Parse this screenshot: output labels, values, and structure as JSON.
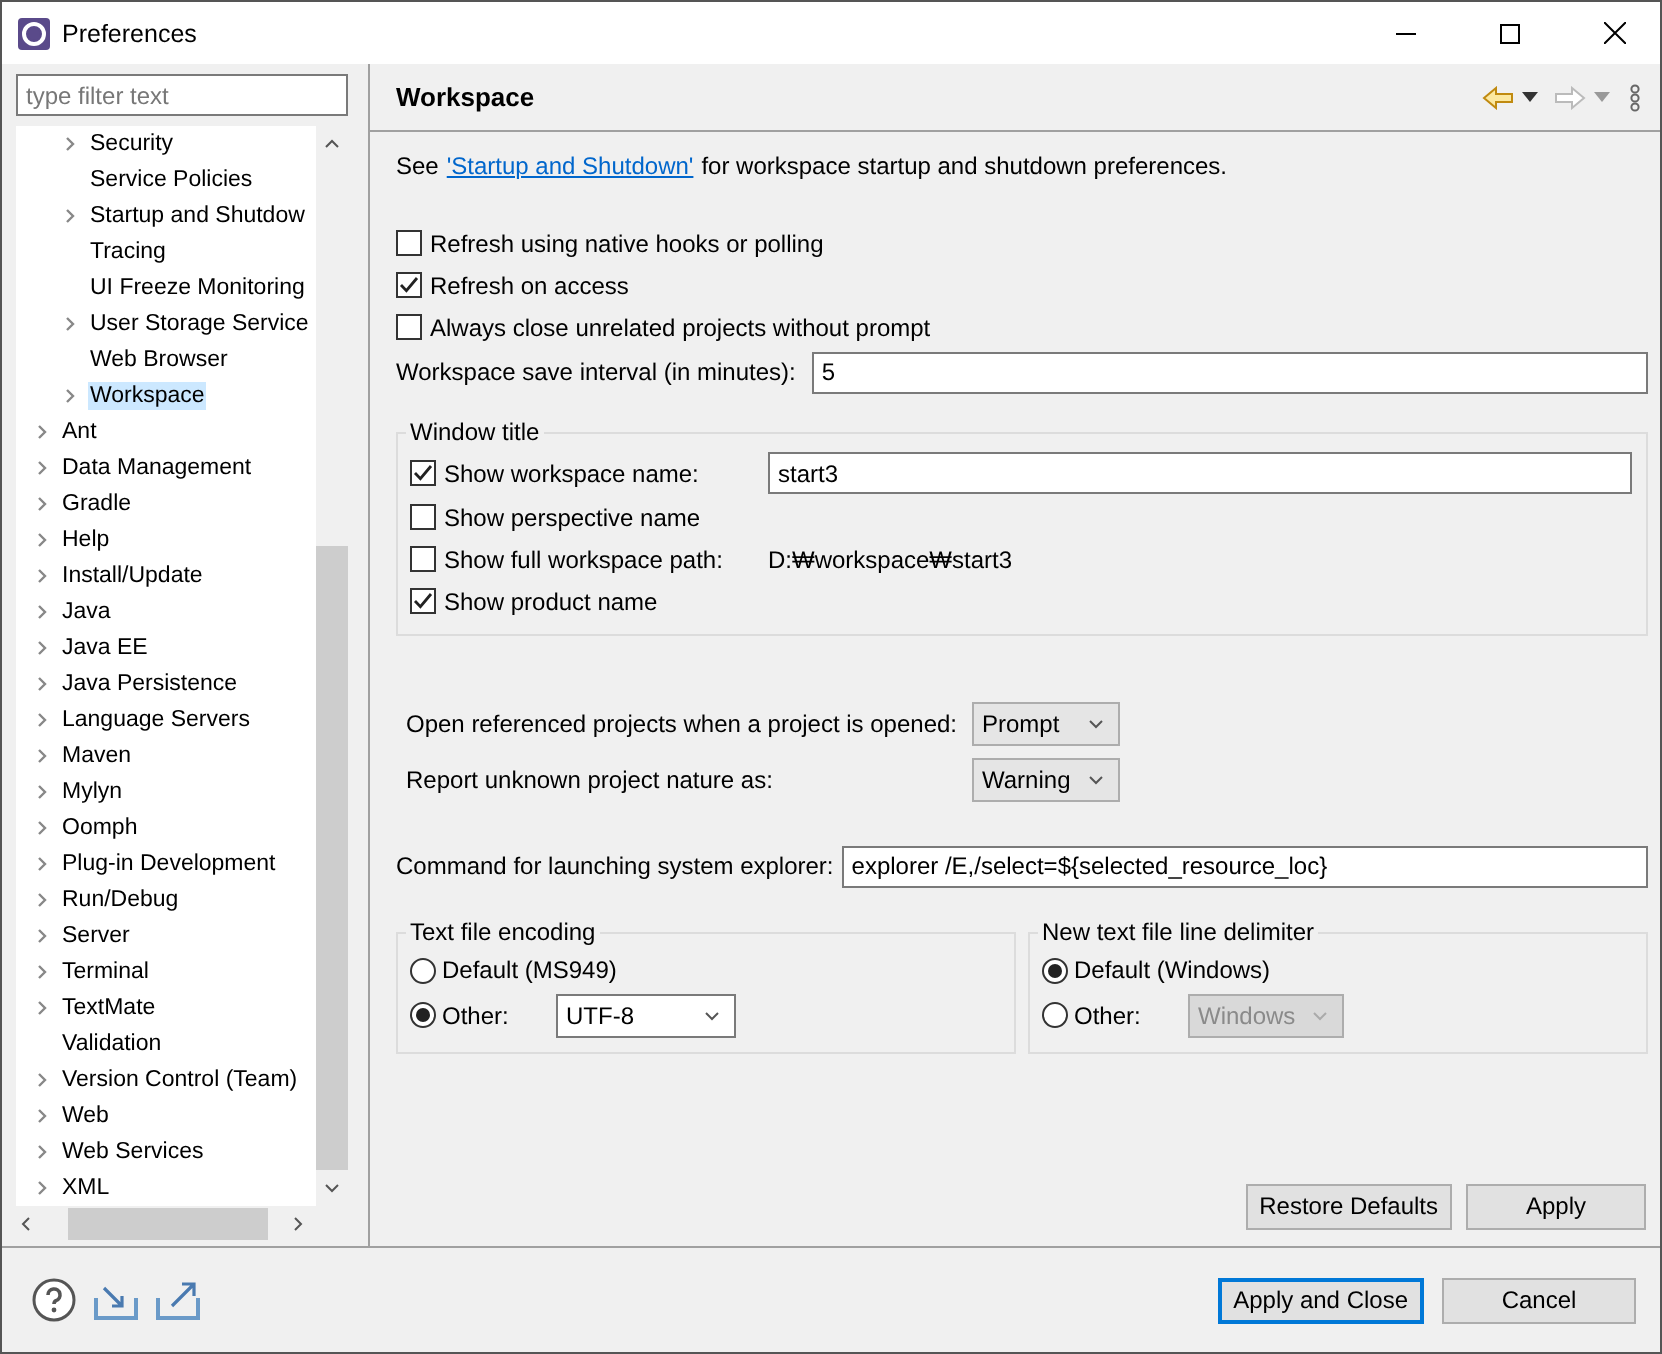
{
  "window": {
    "title": "Preferences"
  },
  "filter": {
    "placeholder": "type filter text"
  },
  "tree": {
    "nested_items": [
      {
        "label": "Security",
        "expandable": true,
        "selected": false
      },
      {
        "label": "Service Policies",
        "expandable": false,
        "selected": false
      },
      {
        "label": "Startup and Shutdow",
        "expandable": true,
        "selected": false
      },
      {
        "label": "Tracing",
        "expandable": false,
        "selected": false
      },
      {
        "label": "UI Freeze Monitoring",
        "expandable": false,
        "selected": false
      },
      {
        "label": "User Storage Service",
        "expandable": true,
        "selected": false
      },
      {
        "label": "Web Browser",
        "expandable": false,
        "selected": false
      },
      {
        "label": "Workspace",
        "expandable": true,
        "selected": true
      }
    ],
    "items": [
      {
        "label": "Ant",
        "expandable": true,
        "selected": false
      },
      {
        "label": "Data Management",
        "expandable": true,
        "selected": false
      },
      {
        "label": "Gradle",
        "expandable": true,
        "selected": false
      },
      {
        "label": "Help",
        "expandable": true,
        "selected": false
      },
      {
        "label": "Install/Update",
        "expandable": true,
        "selected": false
      },
      {
        "label": "Java",
        "expandable": true,
        "selected": false
      },
      {
        "label": "Java EE",
        "expandable": true,
        "selected": false
      },
      {
        "label": "Java Persistence",
        "expandable": true,
        "selected": false
      },
      {
        "label": "Language Servers",
        "expandable": true,
        "selected": false
      },
      {
        "label": "Maven",
        "expandable": true,
        "selected": false
      },
      {
        "label": "Mylyn",
        "expandable": true,
        "selected": false
      },
      {
        "label": "Oomph",
        "expandable": true,
        "selected": false
      },
      {
        "label": "Plug-in Development",
        "expandable": true,
        "selected": false
      },
      {
        "label": "Run/Debug",
        "expandable": true,
        "selected": false
      },
      {
        "label": "Server",
        "expandable": true,
        "selected": false
      },
      {
        "label": "Terminal",
        "expandable": true,
        "selected": false
      },
      {
        "label": "TextMate",
        "expandable": true,
        "selected": false
      },
      {
        "label": "Validation",
        "expandable": false,
        "selected": false
      },
      {
        "label": "Version Control (Team)",
        "expandable": true,
        "selected": false
      },
      {
        "label": "Web",
        "expandable": true,
        "selected": false
      },
      {
        "label": "Web Services",
        "expandable": true,
        "selected": false
      },
      {
        "label": "XML",
        "expandable": true,
        "selected": false
      }
    ]
  },
  "page": {
    "title": "Workspace",
    "intro": {
      "before": "See",
      "link": "'Startup and Shutdown'",
      "after": "for workspace startup and shutdown preferences."
    },
    "options": [
      {
        "label": "Refresh using native hooks or polling",
        "checked": false
      },
      {
        "label": "Refresh on access",
        "checked": true
      },
      {
        "label": "Always close unrelated projects without prompt",
        "checked": false
      }
    ],
    "save_interval": {
      "label": "Workspace save interval (in minutes):",
      "value": "5"
    },
    "window_title": {
      "title": "Window title",
      "rows": [
        {
          "kind": "input",
          "label": "Show workspace name:",
          "checked": true,
          "value": "start3"
        },
        {
          "kind": "plain",
          "label": "Show perspective name",
          "checked": false
        },
        {
          "kind": "text",
          "label": "Show full workspace path:",
          "checked": false,
          "value": "D:₩workspace₩start3"
        },
        {
          "kind": "plain",
          "label": "Show product name",
          "checked": true
        }
      ]
    },
    "selects": [
      {
        "label": "Open referenced projects when a project is opened:",
        "value": "Prompt"
      },
      {
        "label": "Report unknown project nature as:",
        "value": "Warning"
      }
    ],
    "explorer": {
      "label": "Command for launching system explorer:",
      "value": "explorer /E,/select=${selected_resource_loc}"
    },
    "encoding": {
      "title": "Text file encoding",
      "options": [
        {
          "kind": "plain",
          "label": "Default (MS949)",
          "selected": false
        },
        {
          "kind": "combo",
          "label": "Other:",
          "selected": true,
          "value": "UTF-8",
          "disabled": false
        }
      ]
    },
    "delimiter": {
      "title": "New text file line delimiter",
      "options": [
        {
          "kind": "plain",
          "label": "Default (Windows)",
          "selected": true
        },
        {
          "kind": "combo",
          "label": "Other:",
          "selected": false,
          "value": "Windows",
          "disabled": true
        }
      ]
    },
    "buttons": [
      "Restore Defaults",
      "Apply"
    ]
  },
  "footer_buttons": [
    {
      "label": "Apply and Close",
      "default": true
    },
    {
      "label": "Cancel",
      "default": false
    }
  ]
}
